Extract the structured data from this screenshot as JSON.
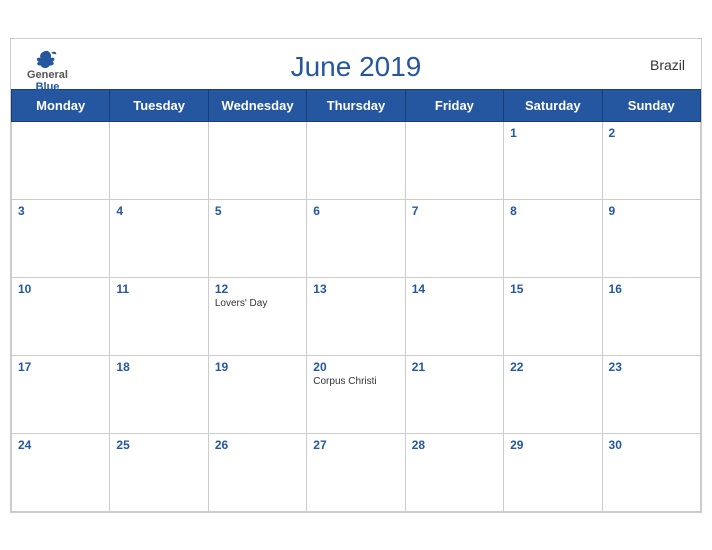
{
  "header": {
    "title": "June 2019",
    "country": "Brazil",
    "logo": {
      "general": "General",
      "blue": "Blue"
    }
  },
  "weekdays": [
    "Monday",
    "Tuesday",
    "Wednesday",
    "Thursday",
    "Friday",
    "Saturday",
    "Sunday"
  ],
  "weeks": [
    [
      {
        "day": "",
        "empty": true
      },
      {
        "day": "",
        "empty": true
      },
      {
        "day": "",
        "empty": true
      },
      {
        "day": "",
        "empty": true
      },
      {
        "day": "",
        "empty": true
      },
      {
        "day": "1",
        "empty": false,
        "event": ""
      },
      {
        "day": "2",
        "empty": false,
        "event": ""
      }
    ],
    [
      {
        "day": "3",
        "empty": false,
        "event": ""
      },
      {
        "day": "4",
        "empty": false,
        "event": ""
      },
      {
        "day": "5",
        "empty": false,
        "event": ""
      },
      {
        "day": "6",
        "empty": false,
        "event": ""
      },
      {
        "day": "7",
        "empty": false,
        "event": ""
      },
      {
        "day": "8",
        "empty": false,
        "event": ""
      },
      {
        "day": "9",
        "empty": false,
        "event": ""
      }
    ],
    [
      {
        "day": "10",
        "empty": false,
        "event": ""
      },
      {
        "day": "11",
        "empty": false,
        "event": ""
      },
      {
        "day": "12",
        "empty": false,
        "event": "Lovers' Day"
      },
      {
        "day": "13",
        "empty": false,
        "event": ""
      },
      {
        "day": "14",
        "empty": false,
        "event": ""
      },
      {
        "day": "15",
        "empty": false,
        "event": ""
      },
      {
        "day": "16",
        "empty": false,
        "event": ""
      }
    ],
    [
      {
        "day": "17",
        "empty": false,
        "event": ""
      },
      {
        "day": "18",
        "empty": false,
        "event": ""
      },
      {
        "day": "19",
        "empty": false,
        "event": ""
      },
      {
        "day": "20",
        "empty": false,
        "event": "Corpus Christi"
      },
      {
        "day": "21",
        "empty": false,
        "event": ""
      },
      {
        "day": "22",
        "empty": false,
        "event": ""
      },
      {
        "day": "23",
        "empty": false,
        "event": ""
      }
    ],
    [
      {
        "day": "24",
        "empty": false,
        "event": ""
      },
      {
        "day": "25",
        "empty": false,
        "event": ""
      },
      {
        "day": "26",
        "empty": false,
        "event": ""
      },
      {
        "day": "27",
        "empty": false,
        "event": ""
      },
      {
        "day": "28",
        "empty": false,
        "event": ""
      },
      {
        "day": "29",
        "empty": false,
        "event": ""
      },
      {
        "day": "30",
        "empty": false,
        "event": ""
      }
    ]
  ]
}
